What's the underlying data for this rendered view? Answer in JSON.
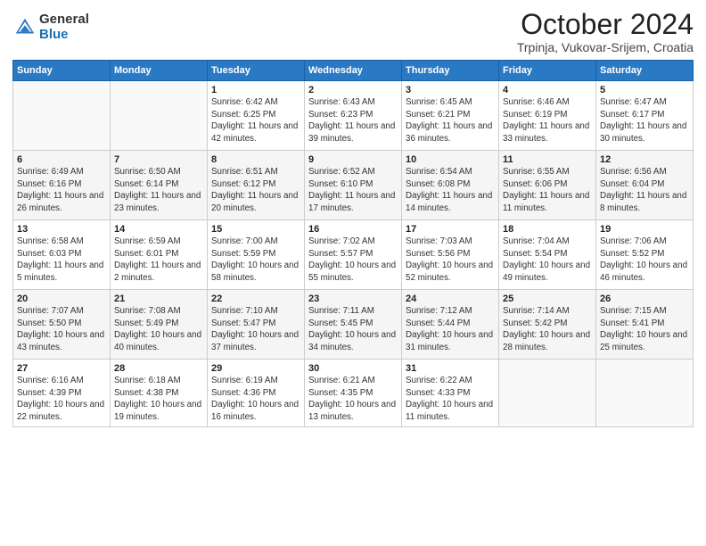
{
  "header": {
    "logo_general": "General",
    "logo_blue": "Blue",
    "month_title": "October 2024",
    "location": "Trpinja, Vukovar-Srijem, Croatia"
  },
  "weekdays": [
    "Sunday",
    "Monday",
    "Tuesday",
    "Wednesday",
    "Thursday",
    "Friday",
    "Saturday"
  ],
  "weeks": [
    [
      {
        "day": "",
        "detail": ""
      },
      {
        "day": "",
        "detail": ""
      },
      {
        "day": "1",
        "detail": "Sunrise: 6:42 AM\nSunset: 6:25 PM\nDaylight: 11 hours and 42 minutes."
      },
      {
        "day": "2",
        "detail": "Sunrise: 6:43 AM\nSunset: 6:23 PM\nDaylight: 11 hours and 39 minutes."
      },
      {
        "day": "3",
        "detail": "Sunrise: 6:45 AM\nSunset: 6:21 PM\nDaylight: 11 hours and 36 minutes."
      },
      {
        "day": "4",
        "detail": "Sunrise: 6:46 AM\nSunset: 6:19 PM\nDaylight: 11 hours and 33 minutes."
      },
      {
        "day": "5",
        "detail": "Sunrise: 6:47 AM\nSunset: 6:17 PM\nDaylight: 11 hours and 30 minutes."
      }
    ],
    [
      {
        "day": "6",
        "detail": "Sunrise: 6:49 AM\nSunset: 6:16 PM\nDaylight: 11 hours and 26 minutes."
      },
      {
        "day": "7",
        "detail": "Sunrise: 6:50 AM\nSunset: 6:14 PM\nDaylight: 11 hours and 23 minutes."
      },
      {
        "day": "8",
        "detail": "Sunrise: 6:51 AM\nSunset: 6:12 PM\nDaylight: 11 hours and 20 minutes."
      },
      {
        "day": "9",
        "detail": "Sunrise: 6:52 AM\nSunset: 6:10 PM\nDaylight: 11 hours and 17 minutes."
      },
      {
        "day": "10",
        "detail": "Sunrise: 6:54 AM\nSunset: 6:08 PM\nDaylight: 11 hours and 14 minutes."
      },
      {
        "day": "11",
        "detail": "Sunrise: 6:55 AM\nSunset: 6:06 PM\nDaylight: 11 hours and 11 minutes."
      },
      {
        "day": "12",
        "detail": "Sunrise: 6:56 AM\nSunset: 6:04 PM\nDaylight: 11 hours and 8 minutes."
      }
    ],
    [
      {
        "day": "13",
        "detail": "Sunrise: 6:58 AM\nSunset: 6:03 PM\nDaylight: 11 hours and 5 minutes."
      },
      {
        "day": "14",
        "detail": "Sunrise: 6:59 AM\nSunset: 6:01 PM\nDaylight: 11 hours and 2 minutes."
      },
      {
        "day": "15",
        "detail": "Sunrise: 7:00 AM\nSunset: 5:59 PM\nDaylight: 10 hours and 58 minutes."
      },
      {
        "day": "16",
        "detail": "Sunrise: 7:02 AM\nSunset: 5:57 PM\nDaylight: 10 hours and 55 minutes."
      },
      {
        "day": "17",
        "detail": "Sunrise: 7:03 AM\nSunset: 5:56 PM\nDaylight: 10 hours and 52 minutes."
      },
      {
        "day": "18",
        "detail": "Sunrise: 7:04 AM\nSunset: 5:54 PM\nDaylight: 10 hours and 49 minutes."
      },
      {
        "day": "19",
        "detail": "Sunrise: 7:06 AM\nSunset: 5:52 PM\nDaylight: 10 hours and 46 minutes."
      }
    ],
    [
      {
        "day": "20",
        "detail": "Sunrise: 7:07 AM\nSunset: 5:50 PM\nDaylight: 10 hours and 43 minutes."
      },
      {
        "day": "21",
        "detail": "Sunrise: 7:08 AM\nSunset: 5:49 PM\nDaylight: 10 hours and 40 minutes."
      },
      {
        "day": "22",
        "detail": "Sunrise: 7:10 AM\nSunset: 5:47 PM\nDaylight: 10 hours and 37 minutes."
      },
      {
        "day": "23",
        "detail": "Sunrise: 7:11 AM\nSunset: 5:45 PM\nDaylight: 10 hours and 34 minutes."
      },
      {
        "day": "24",
        "detail": "Sunrise: 7:12 AM\nSunset: 5:44 PM\nDaylight: 10 hours and 31 minutes."
      },
      {
        "day": "25",
        "detail": "Sunrise: 7:14 AM\nSunset: 5:42 PM\nDaylight: 10 hours and 28 minutes."
      },
      {
        "day": "26",
        "detail": "Sunrise: 7:15 AM\nSunset: 5:41 PM\nDaylight: 10 hours and 25 minutes."
      }
    ],
    [
      {
        "day": "27",
        "detail": "Sunrise: 6:16 AM\nSunset: 4:39 PM\nDaylight: 10 hours and 22 minutes."
      },
      {
        "day": "28",
        "detail": "Sunrise: 6:18 AM\nSunset: 4:38 PM\nDaylight: 10 hours and 19 minutes."
      },
      {
        "day": "29",
        "detail": "Sunrise: 6:19 AM\nSunset: 4:36 PM\nDaylight: 10 hours and 16 minutes."
      },
      {
        "day": "30",
        "detail": "Sunrise: 6:21 AM\nSunset: 4:35 PM\nDaylight: 10 hours and 13 minutes."
      },
      {
        "day": "31",
        "detail": "Sunrise: 6:22 AM\nSunset: 4:33 PM\nDaylight: 10 hours and 11 minutes."
      },
      {
        "day": "",
        "detail": ""
      },
      {
        "day": "",
        "detail": ""
      }
    ]
  ]
}
